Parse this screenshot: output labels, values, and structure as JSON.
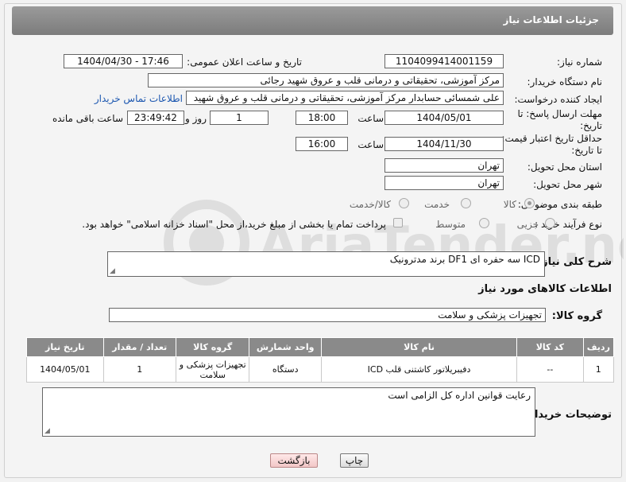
{
  "header": {
    "title": "جزئیات اطلاعات نیاز"
  },
  "fields": {
    "need_number_label": "شماره نیاز:",
    "need_number": "1104099414001159",
    "announce_label": "تاریخ و ساعت اعلان عمومی:",
    "announce_value": "1404/04/30 - 17:46",
    "buyer_org_label": "نام دستگاه خریدار:",
    "buyer_org": "مرکز آموزشی، تحقیقاتی و درمانی قلب و عروق شهید رجائی",
    "creator_label": "ایجاد کننده درخواست:",
    "creator": "علی شمسائی حسابدار مرکز آموزشی، تحقیقاتی و درمانی قلب و عروق شهید",
    "buyer_contact_link": "اطلاعات تماس خریدار",
    "deadline_label": "مهلت ارسال پاسخ: تا تاریخ:",
    "deadline_date": "1404/05/01",
    "time_label": "ساعت",
    "deadline_time": "18:00",
    "days": "1",
    "days_label": "روز و",
    "remaining": "23:49:42",
    "remaining_label": "ساعت باقی مانده",
    "validity_label": "حداقل تاریخ اعتبار قیمت: تا تاریخ:",
    "validity_date": "1404/11/30",
    "validity_time": "16:00",
    "province_label": "استان محل تحویل:",
    "province": "تهران",
    "city_label": "شهر محل تحویل:",
    "city": "تهران",
    "category_label": "طبقه بندی موضوعی:",
    "category_options": [
      "کالا",
      "خدمت",
      "کالا/خدمت"
    ],
    "process_label": "نوع فرآیند خرید :",
    "process_options": [
      "جزیی",
      "متوسط"
    ],
    "payment_note": "پرداخت تمام یا بخشی از مبلغ خرید،از محل \"اسناد خزانه اسلامی\" خواهد بود."
  },
  "description": {
    "label": "شرح کلی نیاز:",
    "value": "ICD سه حفره ای DF1 برند مدترونیک"
  },
  "goods_info": {
    "title": "اطلاعات کالاهای مورد نیاز",
    "group_label": "گروه کالا:",
    "group_value": "تجهیزات پزشکی و سلامت"
  },
  "table": {
    "headers": [
      "ردیف",
      "کد کالا",
      "نام کالا",
      "واحد شمارش",
      "گروه کالا",
      "تعداد / مقدار",
      "تاریخ نیاز"
    ],
    "rows": [
      [
        "1",
        "--",
        "دفیبریلاتور کاشتنی قلب ICD",
        "دستگاه",
        "تجهیزات پزشکی و سلامت",
        "1",
        "1404/05/01"
      ]
    ]
  },
  "buyer_notes": {
    "label": "توضیحات خریدار:",
    "value": "رعایت قوانین اداره کل الزامی است"
  },
  "buttons": {
    "print": "چاپ",
    "back": "بازگشت"
  },
  "watermark": {
    "text": "AriaTender.neT"
  }
}
